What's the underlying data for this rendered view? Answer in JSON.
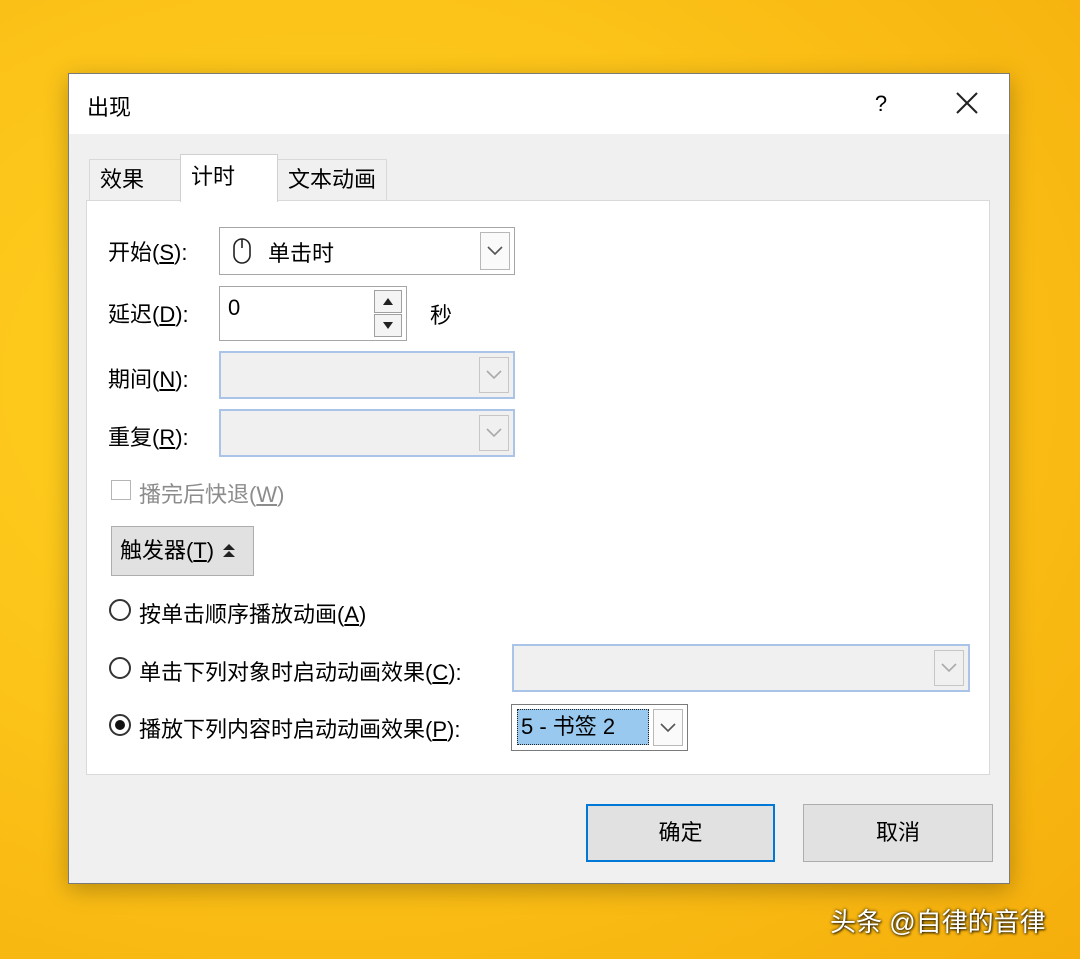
{
  "dialog": {
    "title": "出现",
    "help": "?"
  },
  "tabs": [
    {
      "label": "效果",
      "active": false
    },
    {
      "label": "计时",
      "active": true
    },
    {
      "label": "文本动画",
      "active": false
    }
  ],
  "timing": {
    "start_label": "开始(",
    "start_key": "S",
    "start_suffix": "):",
    "start_value": "单击时",
    "delay_label": "延迟(",
    "delay_key": "D",
    "delay_suffix": "):",
    "delay_value": "0",
    "delay_unit": "秒",
    "duration_label": "期间(",
    "duration_key": "N",
    "duration_suffix": "):",
    "repeat_label": "重复(",
    "repeat_key": "R",
    "repeat_suffix": "):",
    "rewind_label": "播完后快退(",
    "rewind_key": "W",
    "rewind_suffix": ")",
    "rewind_checked": false
  },
  "triggers": {
    "button_label": "触发器(",
    "button_key": "T",
    "button_suffix": ") ",
    "button_icon": "▲▲",
    "options": [
      {
        "label": "按单击顺序播放动画(",
        "key": "A",
        "suffix": ")",
        "checked": false
      },
      {
        "label": "单击下列对象时启动动画效果(",
        "key": "C",
        "suffix": "):",
        "checked": false
      },
      {
        "label": "播放下列内容时启动动画效果(",
        "key": "P",
        "suffix": "):",
        "checked": true
      }
    ],
    "bookmark_value": "5 - 书签 2"
  },
  "buttons": {
    "ok": "确定",
    "cancel": "取消"
  },
  "watermark": "头条 @自律的音律",
  "colors": {
    "background": "#fcc419",
    "selection": "#99c9ef",
    "focus": "#0078d7"
  }
}
